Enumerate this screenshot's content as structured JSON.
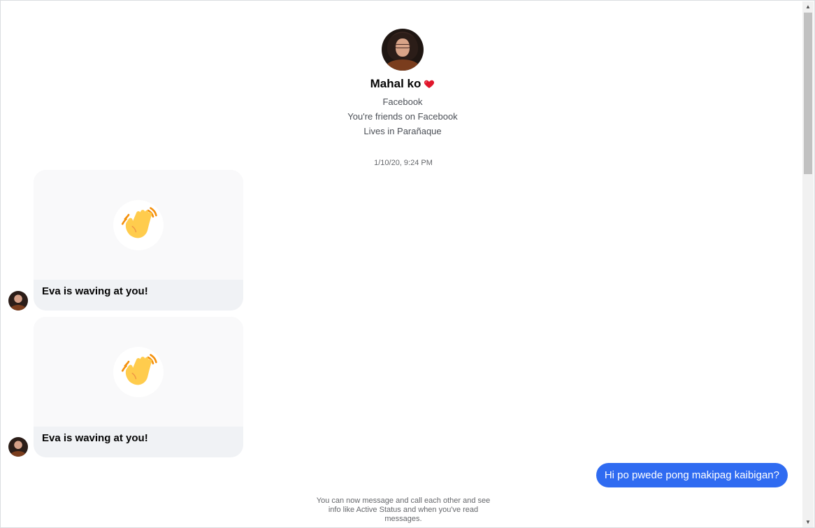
{
  "profile": {
    "name": "Mahal ko",
    "heart": "❤️",
    "platform": "Facebook",
    "friendship": "You're friends on Facebook",
    "location": "Lives in Parañaque"
  },
  "timestamp": "1/10/20, 9:24 PM",
  "messages": [
    {
      "type": "wave",
      "caption": "Eva is waving at you!",
      "emoji": "👋"
    },
    {
      "type": "wave",
      "caption": "Eva is waving at you!",
      "emoji": "👋"
    },
    {
      "type": "outgoing",
      "text": "Hi po pwede pong makipag kaibigan?"
    }
  ],
  "footer_note": "You can now message and call each other and see info like Active Status and when you've read messages.",
  "colors": {
    "outgoing_bubble": "#2f6bf1",
    "card_caption_bg": "#f0f2f5",
    "muted_text": "#65676b"
  }
}
